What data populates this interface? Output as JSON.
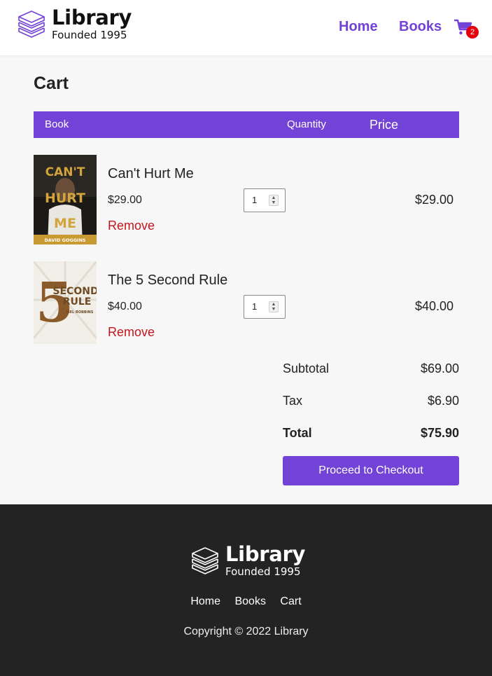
{
  "header": {
    "logo_title": "Library",
    "logo_subtitle": "Founded 1995",
    "nav": {
      "home": "Home",
      "books": "Books"
    },
    "cart_count": "2",
    "icons": {
      "logo": "books-stack-icon",
      "cart": "shopping-cart-icon"
    }
  },
  "page": {
    "title": "Cart"
  },
  "table": {
    "headers": {
      "book": "Book",
      "quantity": "Quantity",
      "price": "Price"
    },
    "rows": [
      {
        "title": "Can't Hurt Me",
        "price": "$29.00",
        "quantity": "1",
        "total": "$29.00",
        "remove": "Remove",
        "cover_text": [
          "CAN'T",
          "HURT",
          "ME"
        ],
        "cover_author": "DAVID GOGGINS"
      },
      {
        "title": "The 5 Second Rule",
        "price": "$40.00",
        "quantity": "1",
        "total": "$40.00",
        "remove": "Remove",
        "cover_text": [
          "5",
          "SECOND",
          "RULE"
        ],
        "cover_author": "MEL ROBBINS"
      }
    ]
  },
  "summary": {
    "subtotal_label": "Subtotal",
    "subtotal": "$69.00",
    "tax_label": "Tax",
    "tax": "$6.90",
    "total_label": "Total",
    "total": "$75.90",
    "checkout_label": "Proceed to Checkout"
  },
  "footer": {
    "logo_title": "Library",
    "logo_subtitle": "Founded 1995",
    "links": {
      "home": "Home",
      "books": "Books",
      "cart": "Cart"
    },
    "copyright": "Copyright © 2022 Library"
  },
  "colors": {
    "accent": "#7342d6",
    "remove": "#c4161c",
    "badge": "#e5000a",
    "footer_bg": "#232323"
  }
}
